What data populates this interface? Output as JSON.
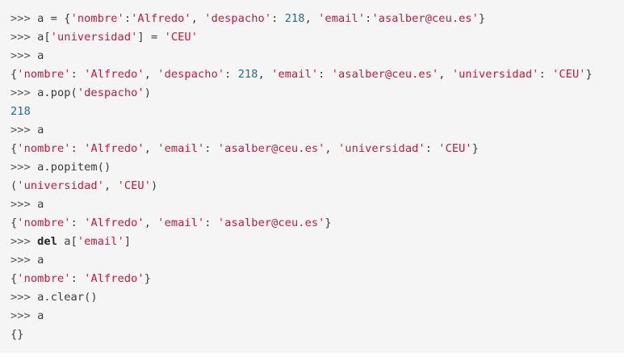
{
  "code": {
    "lines": [
      {
        "segments": [
          {
            "text": ">>> ",
            "type": "prompt"
          },
          {
            "text": "a = {",
            "type": "plain"
          },
          {
            "text": "'nombre'",
            "type": "string"
          },
          {
            "text": ":",
            "type": "plain"
          },
          {
            "text": "'Alfredo'",
            "type": "string"
          },
          {
            "text": ", ",
            "type": "plain"
          },
          {
            "text": "'despacho'",
            "type": "string"
          },
          {
            "text": ": ",
            "type": "plain"
          },
          {
            "text": "218",
            "type": "number"
          },
          {
            "text": ", ",
            "type": "plain"
          },
          {
            "text": "'email'",
            "type": "string"
          },
          {
            "text": ":",
            "type": "plain"
          },
          {
            "text": "'asalber@ceu.es'",
            "type": "string"
          },
          {
            "text": "}",
            "type": "plain"
          }
        ]
      },
      {
        "segments": [
          {
            "text": ">>> ",
            "type": "prompt"
          },
          {
            "text": "a[",
            "type": "plain"
          },
          {
            "text": "'universidad'",
            "type": "string"
          },
          {
            "text": "] = ",
            "type": "plain"
          },
          {
            "text": "'CEU'",
            "type": "string"
          }
        ]
      },
      {
        "segments": [
          {
            "text": ">>> ",
            "type": "prompt"
          },
          {
            "text": "a",
            "type": "plain"
          }
        ]
      },
      {
        "segments": [
          {
            "text": "{",
            "type": "plain"
          },
          {
            "text": "'nombre'",
            "type": "string"
          },
          {
            "text": ": ",
            "type": "plain"
          },
          {
            "text": "'Alfredo'",
            "type": "string"
          },
          {
            "text": ", ",
            "type": "plain"
          },
          {
            "text": "'despacho'",
            "type": "string"
          },
          {
            "text": ": ",
            "type": "plain"
          },
          {
            "text": "218",
            "type": "number"
          },
          {
            "text": ", ",
            "type": "plain"
          },
          {
            "text": "'email'",
            "type": "string"
          },
          {
            "text": ": ",
            "type": "plain"
          },
          {
            "text": "'asalber@ceu.es'",
            "type": "string"
          },
          {
            "text": ", ",
            "type": "plain"
          },
          {
            "text": "'universidad'",
            "type": "string"
          },
          {
            "text": ": ",
            "type": "plain"
          },
          {
            "text": "'CEU'",
            "type": "string"
          },
          {
            "text": "}",
            "type": "plain"
          }
        ]
      },
      {
        "segments": [
          {
            "text": ">>> ",
            "type": "prompt"
          },
          {
            "text": "a.pop(",
            "type": "plain"
          },
          {
            "text": "'despacho'",
            "type": "string"
          },
          {
            "text": ")",
            "type": "plain"
          }
        ]
      },
      {
        "segments": [
          {
            "text": "218",
            "type": "number"
          }
        ]
      },
      {
        "segments": [
          {
            "text": ">>> ",
            "type": "prompt"
          },
          {
            "text": "a",
            "type": "plain"
          }
        ]
      },
      {
        "segments": [
          {
            "text": "{",
            "type": "plain"
          },
          {
            "text": "'nombre'",
            "type": "string"
          },
          {
            "text": ": ",
            "type": "plain"
          },
          {
            "text": "'Alfredo'",
            "type": "string"
          },
          {
            "text": ", ",
            "type": "plain"
          },
          {
            "text": "'email'",
            "type": "string"
          },
          {
            "text": ": ",
            "type": "plain"
          },
          {
            "text": "'asalber@ceu.es'",
            "type": "string"
          },
          {
            "text": ", ",
            "type": "plain"
          },
          {
            "text": "'universidad'",
            "type": "string"
          },
          {
            "text": ": ",
            "type": "plain"
          },
          {
            "text": "'CEU'",
            "type": "string"
          },
          {
            "text": "}",
            "type": "plain"
          }
        ]
      },
      {
        "segments": [
          {
            "text": ">>> ",
            "type": "prompt"
          },
          {
            "text": "a.popitem()",
            "type": "plain"
          }
        ]
      },
      {
        "segments": [
          {
            "text": "(",
            "type": "plain"
          },
          {
            "text": "'universidad'",
            "type": "string"
          },
          {
            "text": ", ",
            "type": "plain"
          },
          {
            "text": "'CEU'",
            "type": "string"
          },
          {
            "text": ")",
            "type": "plain"
          }
        ]
      },
      {
        "segments": [
          {
            "text": ">>> ",
            "type": "prompt"
          },
          {
            "text": "a",
            "type": "plain"
          }
        ]
      },
      {
        "segments": [
          {
            "text": "{",
            "type": "plain"
          },
          {
            "text": "'nombre'",
            "type": "string"
          },
          {
            "text": ": ",
            "type": "plain"
          },
          {
            "text": "'Alfredo'",
            "type": "string"
          },
          {
            "text": ", ",
            "type": "plain"
          },
          {
            "text": "'email'",
            "type": "string"
          },
          {
            "text": ": ",
            "type": "plain"
          },
          {
            "text": "'asalber@ceu.es'",
            "type": "string"
          },
          {
            "text": "}",
            "type": "plain"
          }
        ]
      },
      {
        "segments": [
          {
            "text": ">>> ",
            "type": "prompt"
          },
          {
            "text": "del",
            "type": "keyword"
          },
          {
            "text": " a[",
            "type": "plain"
          },
          {
            "text": "'email'",
            "type": "string"
          },
          {
            "text": "]",
            "type": "plain"
          }
        ]
      },
      {
        "segments": [
          {
            "text": ">>> ",
            "type": "prompt"
          },
          {
            "text": "a",
            "type": "plain"
          }
        ]
      },
      {
        "segments": [
          {
            "text": "{",
            "type": "plain"
          },
          {
            "text": "'nombre'",
            "type": "string"
          },
          {
            "text": ": ",
            "type": "plain"
          },
          {
            "text": "'Alfredo'",
            "type": "string"
          },
          {
            "text": "}",
            "type": "plain"
          }
        ]
      },
      {
        "segments": [
          {
            "text": ">>> ",
            "type": "prompt"
          },
          {
            "text": "a.clear()",
            "type": "plain"
          }
        ]
      },
      {
        "segments": [
          {
            "text": ">>> ",
            "type": "prompt"
          },
          {
            "text": "a",
            "type": "plain"
          }
        ]
      },
      {
        "segments": [
          {
            "text": "{}",
            "type": "plain"
          }
        ]
      }
    ]
  },
  "colors": {
    "background": "#f5f5f5",
    "string": "#c41a3c",
    "number": "#1c6e8a",
    "prompt": "#555555",
    "text": "#3a3a3a"
  }
}
